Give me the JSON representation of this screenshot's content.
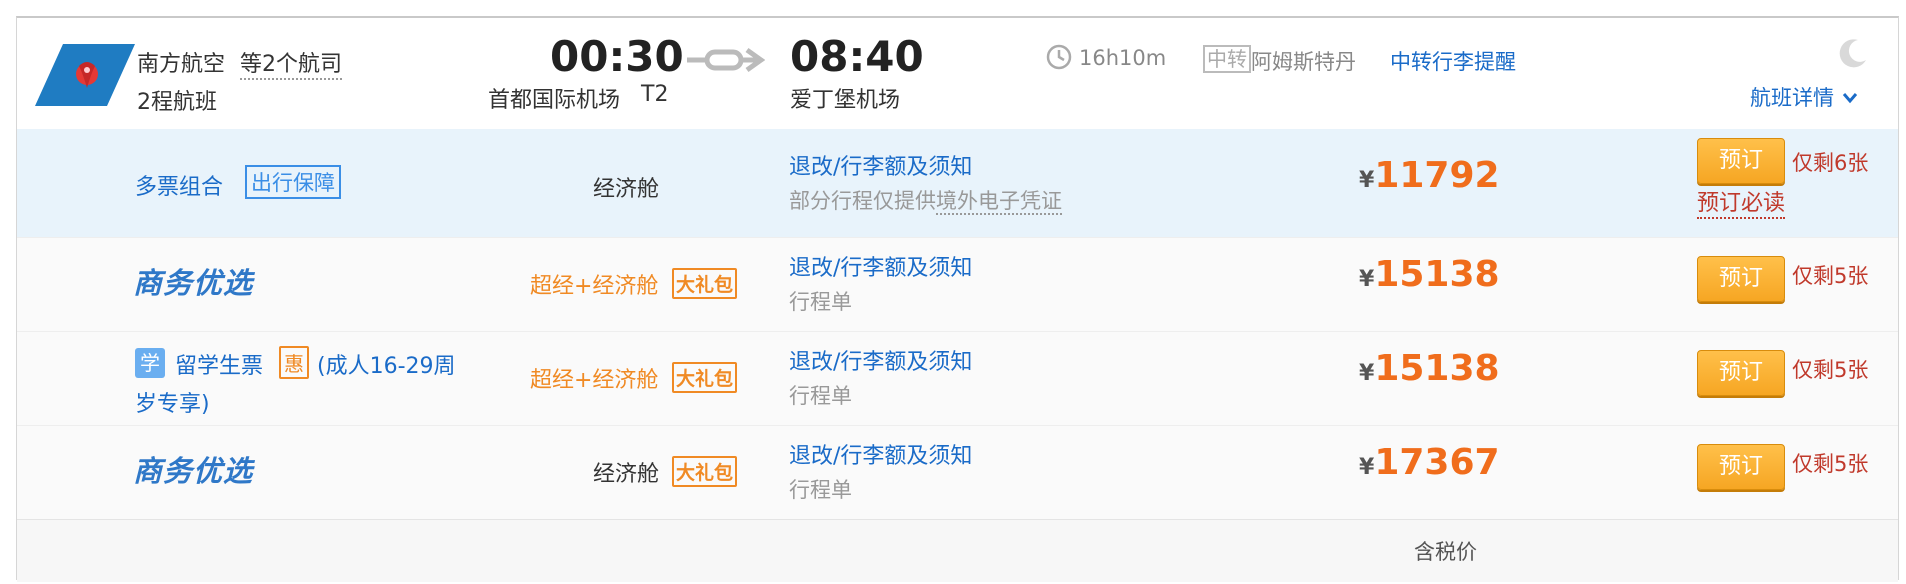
{
  "header": {
    "airline_name": "南方航空",
    "airline_more": "等2个航司",
    "segments": "2程航班",
    "depart_time": "00:30",
    "depart_airport": "首都国际机场",
    "depart_terminal": "T2",
    "arrive_time": "08:40",
    "arrive_airport": "爱丁堡机场",
    "duration": "16h10m",
    "transfer_badge": "中转",
    "transfer_city": "阿姆斯特丹",
    "baggage_notice": "中转行李提醒",
    "details_link": "航班详情"
  },
  "rows": [
    {
      "product": "多票组合",
      "product_tag": "出行保障",
      "cabin": "经济舱",
      "rules": "退改/行李额及须知",
      "note": "部分行程仅提供境外电子凭证",
      "currency": "¥",
      "price": "11792",
      "book": "预订",
      "remaining": "仅剩6张",
      "must_read": "预订必读"
    },
    {
      "product_logo": "商务优选",
      "cabin": "超经+经济舱",
      "gift": "大礼包",
      "rules": "退改/行李额及须知",
      "note": "行程单",
      "currency": "¥",
      "price": "15138",
      "book": "预订",
      "remaining": "仅剩5张"
    },
    {
      "product_icon": "学",
      "product": "留学生票",
      "product_hui": "惠",
      "product_desc_1": "(成人16-29周",
      "product_desc_2": "岁专享)",
      "cabin": "超经+经济舱",
      "gift": "大礼包",
      "rules": "退改/行李额及须知",
      "note": "行程单",
      "currency": "¥",
      "price": "15138",
      "book": "预订",
      "remaining": "仅剩5张"
    },
    {
      "product_logo": "商务优选",
      "cabin": "经济舱",
      "gift": "大礼包",
      "rules": "退改/行李额及须知",
      "note": "行程单",
      "currency": "¥",
      "price": "17367",
      "book": "预订",
      "remaining": "仅剩5张"
    }
  ],
  "footer": {
    "tax_note": "含税价"
  },
  "icons": {
    "airline_logo": "china-southern-logo-icon",
    "arrow": "flight-arrow-icon",
    "clock": "clock-icon",
    "moon": "moon-icon",
    "chevron": "chevron-down-icon"
  },
  "colors": {
    "link_blue": "#1a6bc8",
    "price_orange": "#f06d1c",
    "button_orange": "#f6a623",
    "row_highlight": "#e8f3fb"
  }
}
